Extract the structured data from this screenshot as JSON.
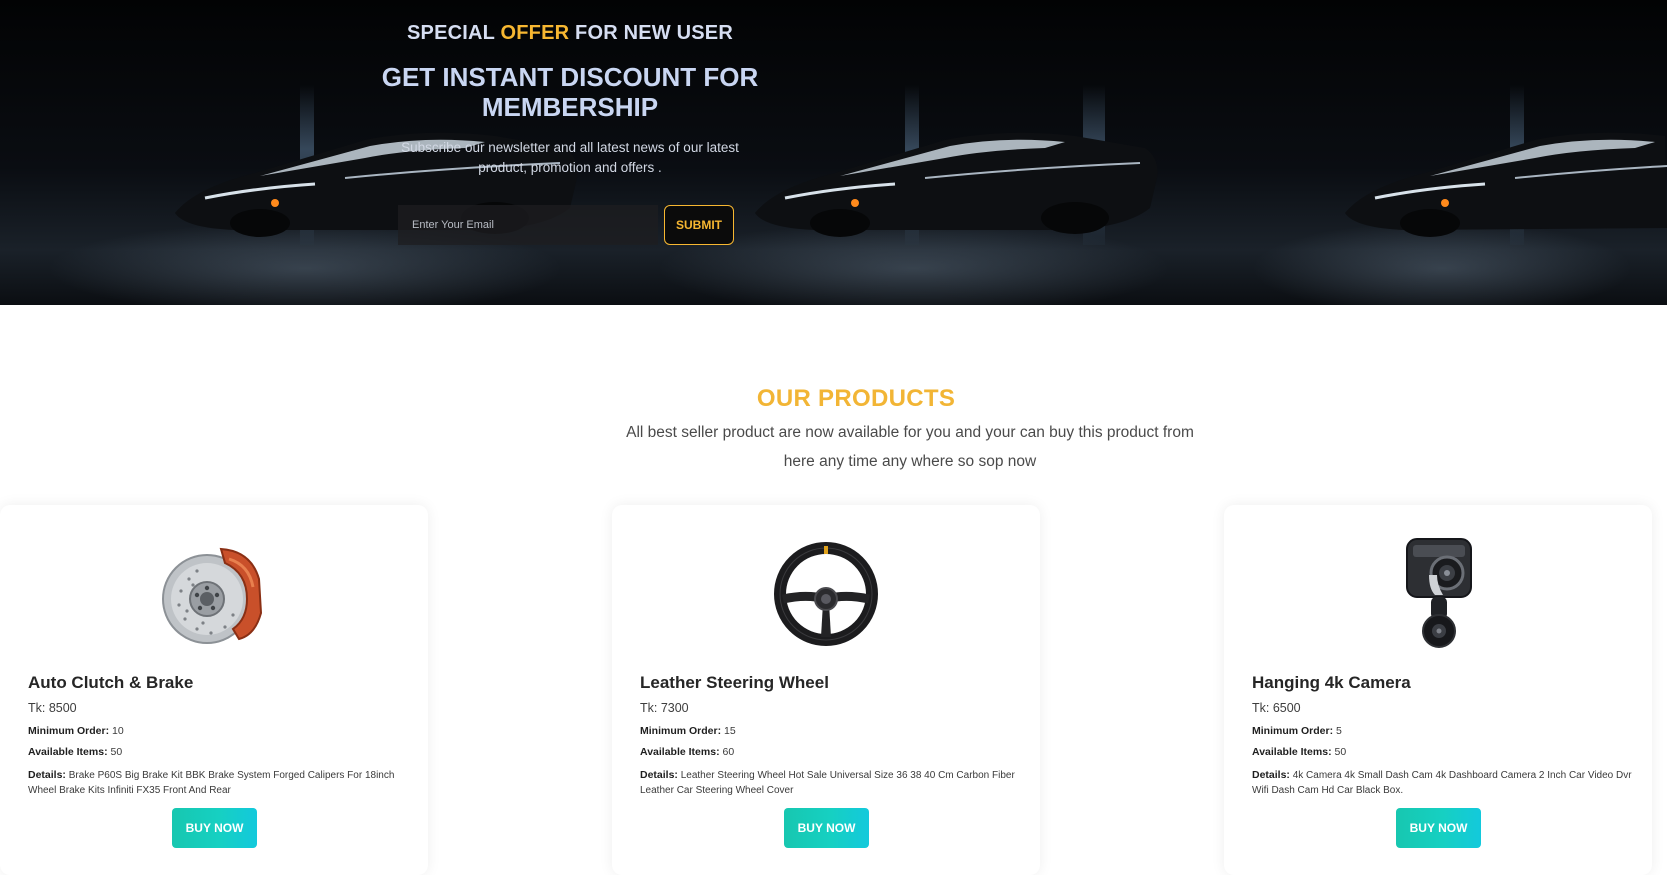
{
  "hero": {
    "eyebrow_prefix": "SPECIAL",
    "eyebrow_accent": "OFFER",
    "eyebrow_suffix": "FOR NEW USER",
    "heading": "GET INSTANT DISCOUNT FOR MEMBERSHIP",
    "subtitle": "Subscribe our newsletter and all latest news of our latest product, promotion and offers .",
    "email_placeholder": "Enter Your Email",
    "email_value": "",
    "submit_label": "SUBMIT",
    "accent_color": "#f7b731"
  },
  "products_section": {
    "title": "OUR PRODUCTS",
    "subtitle": "All best seller product are now available for you and your can buy this product from here any time any where so sop now",
    "title_color": "#f2b535",
    "button_gradient": [
      "#17c7b0",
      "#13c9dc"
    ],
    "min_order_label": "Minimum Order:",
    "available_label": "Available Items:",
    "details_label": "Details:",
    "items": [
      {
        "name": "Auto Clutch & Brake",
        "price": "Tk: 8500",
        "min_order": "10",
        "available": "50",
        "details": "Brake P60S Big Brake Kit BBK Brake System Forged Calipers For 18inch Wheel Brake Kits Infiniti FX35 Front And Rear",
        "buy_label": "BUY NOW",
        "image_icon": "brake-disc-icon"
      },
      {
        "name": "Leather Steering Wheel",
        "price": "Tk: 7300",
        "min_order": "15",
        "available": "60",
        "details": "Leather Steering Wheel Hot Sale Universal Size 36 38 40 Cm Carbon Fiber Leather Car Steering Wheel Cover",
        "buy_label": "BUY NOW",
        "image_icon": "steering-wheel-icon"
      },
      {
        "name": "Hanging 4k Camera",
        "price": "Tk: 6500",
        "min_order": "5",
        "available": "50",
        "details": "4k Camera 4k Small Dash Cam 4k Dashboard Camera 2 Inch Car Video Dvr Wifi Dash Cam Hd Car Black Box.",
        "buy_label": "BUY NOW",
        "image_icon": "dash-camera-icon"
      }
    ]
  }
}
